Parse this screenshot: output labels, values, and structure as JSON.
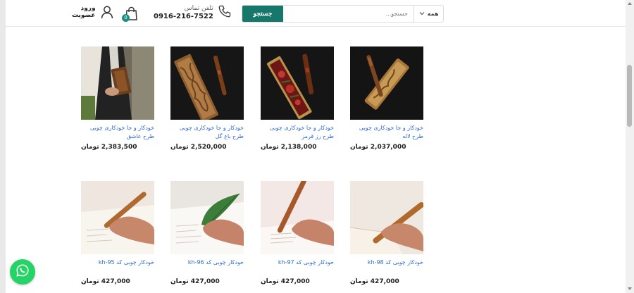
{
  "header": {
    "login_label": "ورود",
    "register_label": "عضویت",
    "cart_count": "0",
    "phone_label": "تلفن تماس",
    "phone_number": "0916-216-7522",
    "search_button": "جستجو",
    "search_placeholder": "جستجو...",
    "search_category": "همه"
  },
  "products": [
    {
      "title": "خودکار و جا خودکاری چوبی طرح لاله",
      "price": "2,037,000 تومان"
    },
    {
      "title": "خودکار و جا خودکاری چوبی طرح رز قرمز",
      "price": "2,138,000 تومان"
    },
    {
      "title": "خودکار و جا خودکاری چوبی طرح باغ گل",
      "price": "2,520,000 تومان"
    },
    {
      "title": "خودکار و جا خودکاری چوبی طرح عاشق",
      "price": "2,383,500 تومان"
    },
    {
      "title": "خودکار چوبی کد kh-98",
      "price": "427,000 تومان"
    },
    {
      "title": "خودکار چوبی کد kh-97",
      "price": "427,000 تومان"
    },
    {
      "title": "خودکار چوبی کد kh-96",
      "price": "427,000 تومان"
    },
    {
      "title": "خودکار چوبی کد kh-95",
      "price": "427,000 تومان"
    }
  ],
  "colors": {
    "accent": "#16786b",
    "link": "#2f6bd1",
    "whatsapp": "#25d366"
  },
  "icons": {
    "user": "user-icon",
    "cart": "shopping-bag-icon",
    "phone": "phone-icon",
    "whatsapp": "whatsapp-icon"
  }
}
